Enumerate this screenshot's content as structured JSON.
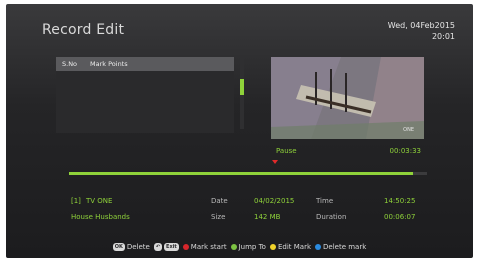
{
  "screen": {
    "title": "Record Edit",
    "date": "Wed, 04Feb2015",
    "time": "20:01"
  },
  "mark_list": {
    "col_sno": "S.No",
    "col_points": "Mark Points",
    "items": []
  },
  "preview": {
    "watermark": "ONE"
  },
  "playback": {
    "status": "Pause",
    "position": "00:03:33",
    "progress_fraction": 0.96
  },
  "recording": {
    "number": "[1]",
    "channel": "TV ONE",
    "program": "House Husbands",
    "date_label": "Date",
    "date_value": "04/02/2015",
    "time_label": "Time",
    "time_value": "14:50:25",
    "size_label": "Size",
    "size_value": "142 MB",
    "duration_label": "Duration",
    "duration_value": "00:06:07"
  },
  "hints": {
    "ok_key": "OK",
    "delete": "Delete",
    "back_key": "↶",
    "exit_key": "Exit",
    "red_label": "Mark start",
    "green_label": "Jump To",
    "yellow_label": "Edit Mark",
    "blue_label": "Delete mark"
  },
  "colors": {
    "accent_green": "#8fd23a",
    "marker_red": "#e02a2a",
    "red": "#d7262b",
    "green": "#7cc242",
    "yellow": "#f0d22a",
    "blue": "#2a8be0"
  }
}
